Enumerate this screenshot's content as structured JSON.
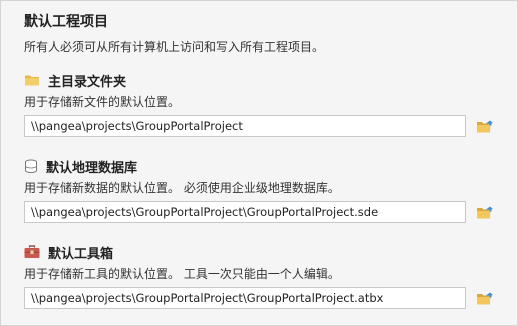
{
  "header": {
    "title": "默认工程项目",
    "subtitle": "所有人必须可从所有计算机上访问和写入所有工程项目。"
  },
  "sections": [
    {
      "icon": "folder-icon",
      "title": "主目录文件夹",
      "description": "用于存储新文件的默认位置。",
      "path": "\\\\pangea\\projects\\GroupPortalProject",
      "browse_icon": "open-folder-icon"
    },
    {
      "icon": "database-icon",
      "title": "默认地理数据库",
      "description": "用于存储新数据的默认位置。 必须使用企业级地理数据库。",
      "path": "\\\\pangea\\projects\\GroupPortalProject\\GroupPortalProject.sde",
      "browse_icon": "open-folder-icon"
    },
    {
      "icon": "toolbox-icon",
      "title": "默认工具箱",
      "description": "用于存储新工具的默认位置。 工具一次只能由一个人编辑。",
      "path": "\\\\pangea\\projects\\GroupPortalProject\\GroupPortalProject.atbx",
      "browse_icon": "open-folder-icon"
    }
  ],
  "colors": {
    "background": "#f5f5f5",
    "folder": "#f0c050",
    "toolbox": "#c0504d",
    "browse_blue": "#3a8fd6"
  }
}
